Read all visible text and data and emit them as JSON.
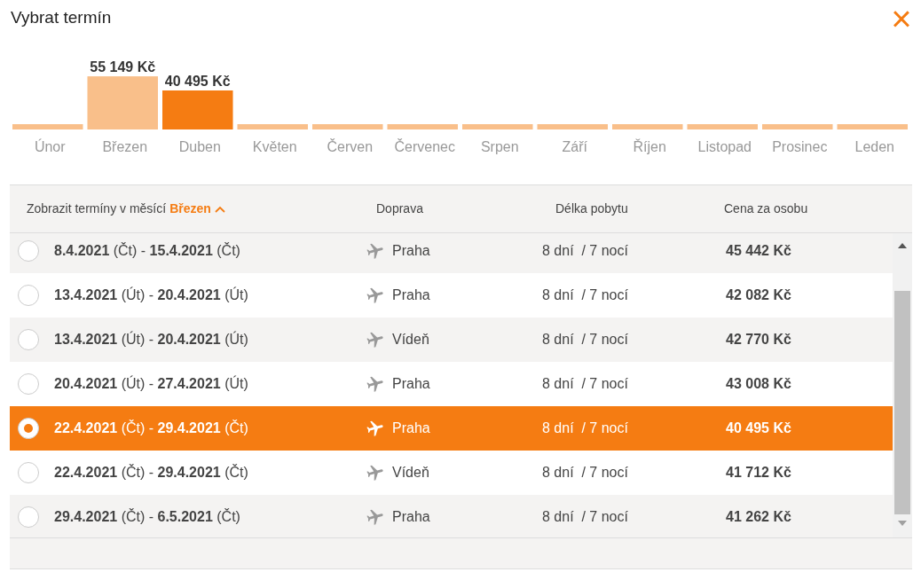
{
  "window": {
    "title": "Vybrat termín",
    "close": "×"
  },
  "months": [
    {
      "label": "Únor",
      "selected": false
    },
    {
      "label": "Březen",
      "price": "55 149 Kč",
      "selected": false
    },
    {
      "label": "Duben",
      "price": "40 495 Kč",
      "selected": true
    },
    {
      "label": "Květen",
      "selected": false
    },
    {
      "label": "Červen",
      "selected": false
    },
    {
      "label": "Červenec",
      "selected": false
    },
    {
      "label": "Srpen",
      "selected": false
    },
    {
      "label": "Září",
      "selected": false
    },
    {
      "label": "Říjen",
      "selected": false
    },
    {
      "label": "Listopad",
      "selected": false
    },
    {
      "label": "Prosinec",
      "selected": false
    },
    {
      "label": "Leden",
      "selected": false
    }
  ],
  "table": {
    "month_filter": {
      "label": "Zobrazit termíny v měsící",
      "month": "Březen",
      "expanded": true
    },
    "columns": [
      "Doprava",
      "Délka pobytu",
      "Cena za osobu"
    ],
    "rows": [
      {
        "dates": "**8.4.2021** (Čt) - **15.4.2021** (Čt)",
        "transport": "Praha",
        "duration": "8 dní  / 7 nocí",
        "price": "45 442 Kč",
        "selected": false
      },
      {
        "dates": "**13.4.2021** (Út) - **20.4.2021** (Út)",
        "transport": "Praha",
        "duration": "8 dní  / 7 nocí",
        "price": "42 082 Kč",
        "selected": false
      },
      {
        "dates": "**13.4.2021** (Út) - **20.4.2021** (Út)",
        "transport": "Vídeň",
        "duration": "8 dní  / 7 nocí",
        "price": "42 770 Kč",
        "selected": false
      },
      {
        "dates": "**20.4.2021** (Út) - **27.4.2021** (Út)",
        "transport": "Praha",
        "duration": "8 dní  / 7 nocí",
        "price": "43 008 Kč",
        "selected": false
      },
      {
        "dates": "**22.4.2021** (Čt) - **29.4.2021** (Čt)",
        "transport": "Praha",
        "duration": "8 dní  / 7 nocí",
        "price": "40 495 Kč",
        "selected": true
      },
      {
        "dates": "**22.4.2021** (Čt) - **29.4.2021** (Čt)",
        "transport": "Vídeň",
        "duration": "8 dní  / 7 nocí",
        "price": "41 712 Kč",
        "selected": false
      },
      {
        "dates": "**29.4.2021** (Čt) - **6.5.2021** (Čt)",
        "transport": "Praha",
        "duration": "8 dní  / 7 nocí",
        "price": "41 262 Kč",
        "selected": false
      }
    ]
  }
}
